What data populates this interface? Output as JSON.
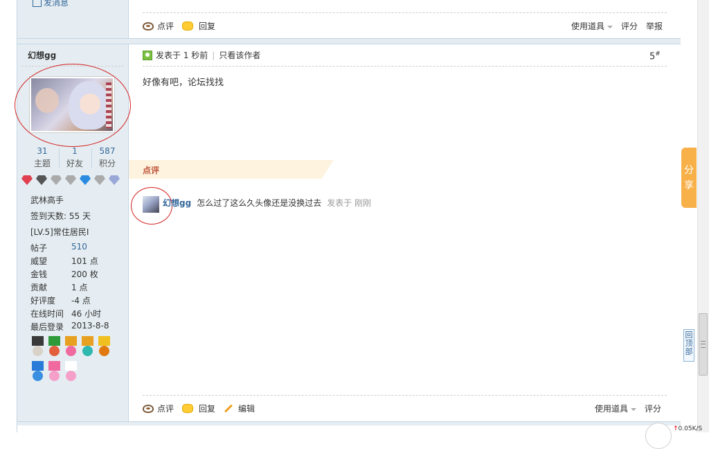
{
  "prev_post": {
    "send_message_label": "发消息",
    "actions": {
      "comment": "点评",
      "reply": "回复"
    },
    "right_actions": {
      "tools": "使用道具",
      "rate": "评分",
      "report": "举报"
    }
  },
  "author": {
    "name": "幻想gg",
    "stats": [
      {
        "num": "31",
        "label": "主题"
      },
      {
        "num": "1",
        "label": "好友"
      },
      {
        "num": "587",
        "label": "积分"
      }
    ],
    "rank_title": "武林高手",
    "checkin": "签到天数: 55 天",
    "level": "[LV.5]常住居民I",
    "details": [
      {
        "key": "帖子",
        "value": "510",
        "link": true
      },
      {
        "key": "威望",
        "value": "101 点"
      },
      {
        "key": "金钱",
        "value": "200 枚"
      },
      {
        "key": "贡献",
        "value": "1 点"
      },
      {
        "key": "好评度",
        "value": "-4 点"
      },
      {
        "key": "在线时间",
        "value": "46 小时"
      },
      {
        "key": "最后登录",
        "value": "2013-8-8"
      }
    ],
    "badge_colors": [
      "#e04050",
      "#555555",
      "#aaaaaa",
      "#aaaaaa",
      "#2a8be0",
      "#aaaaaa",
      "#9aa8d8"
    ],
    "medal_colors": [
      {
        "ribbon": "#3a3a3a",
        "disc": "#d9d2c8"
      },
      {
        "ribbon": "#2e9a3a",
        "disc": "#e2603c"
      },
      {
        "ribbon": "#e8a020",
        "disc": "#f06aa0"
      },
      {
        "ribbon": "#e8a020",
        "disc": "#2fb8b0"
      },
      {
        "ribbon": "#f0c020",
        "disc": "#e07a10"
      },
      {
        "ribbon": "#2a7ad8",
        "disc": "#3a8fe0"
      },
      {
        "ribbon": "#f06aa0",
        "disc": "#f4a0c8"
      },
      {
        "ribbon": "#ffffff",
        "disc": "#f4a0c8"
      }
    ]
  },
  "post": {
    "posted": "发表于 1 秒前",
    "only_author": "只看该作者",
    "floor": "5",
    "floor_sup": "#",
    "content": "好像有吧，论坛找找",
    "comments_title": "点评",
    "comment": {
      "user": "幻想gg",
      "text": "怎么过了这么久头像还是没换过去",
      "time": "发表于 刚刚"
    },
    "actions": {
      "comment": "点评",
      "reply": "回复",
      "edit": "编辑"
    },
    "right_actions": {
      "tools": "使用道具",
      "rate": "评分"
    }
  },
  "share_tab": {
    "line1": "分",
    "line2": "享"
  },
  "back_to_top": "回顶部",
  "net_monitor": {
    "arrow": "↑",
    "speed": "0.05K/S"
  }
}
